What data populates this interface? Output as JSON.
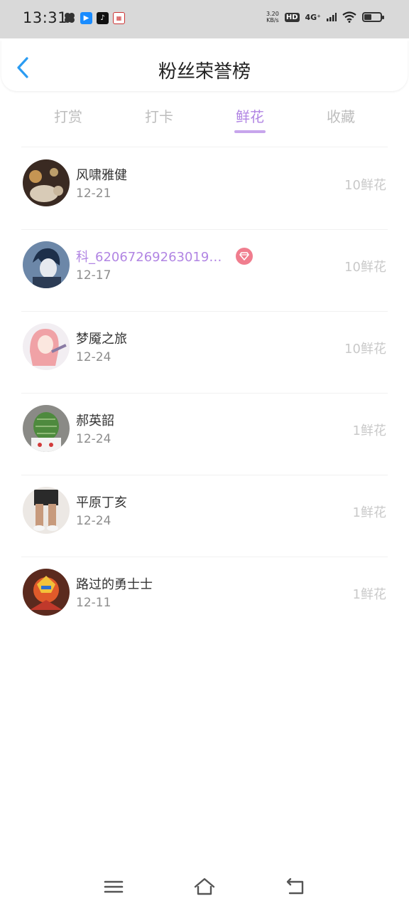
{
  "status_bar": {
    "time": "13:31",
    "speed_value": "3.20",
    "speed_unit": "KB/s",
    "hd": "HD",
    "network": "4G⁺"
  },
  "header": {
    "title": "粉丝荣誉榜"
  },
  "tabs": [
    {
      "label": "打赏"
    },
    {
      "label": "打卡"
    },
    {
      "label": "鲜花"
    },
    {
      "label": "收藏"
    }
  ],
  "active_tab_index": 2,
  "fans": [
    {
      "name": "风啸雅健",
      "date": "12-21",
      "amount": "10鲜花",
      "vip": false
    },
    {
      "name": "科_62067269263019…",
      "date": "12-17",
      "amount": "10鲜花",
      "vip": true
    },
    {
      "name": "梦魇之旅",
      "date": "12-24",
      "amount": "10鲜花",
      "vip": false
    },
    {
      "name": "郝英韶",
      "date": "12-24",
      "amount": "1鲜花",
      "vip": false
    },
    {
      "name": "平原丁亥",
      "date": "12-24",
      "amount": "1鲜花",
      "vip": false
    },
    {
      "name": "路过的勇士士",
      "date": "12-11",
      "amount": "1鲜花",
      "vip": false
    }
  ],
  "colors": {
    "accent": "#b185e3",
    "back_arrow": "#2b9cf2",
    "vip_badge": "#f07d8e"
  }
}
